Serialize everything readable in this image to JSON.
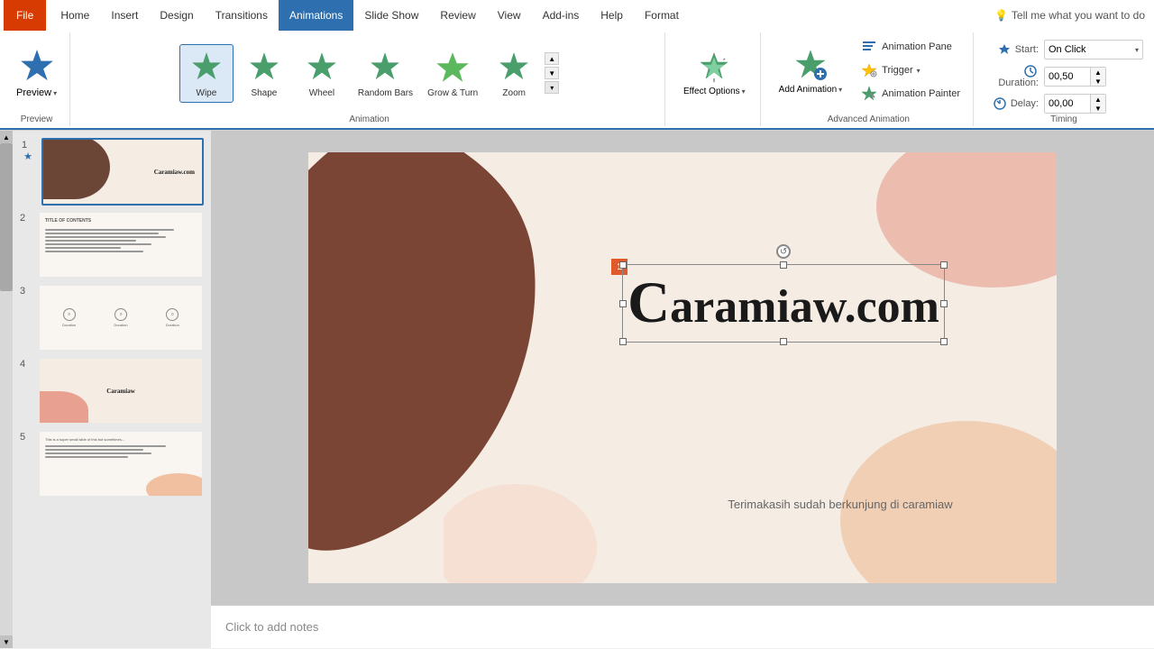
{
  "tabs": {
    "file": "File",
    "home": "Home",
    "insert": "Insert",
    "design": "Design",
    "transitions": "Transitions",
    "animations": "Animations",
    "slideshow": "Slide Show",
    "review": "Review",
    "view": "View",
    "addins": "Add-ins",
    "help": "Help",
    "format": "Format"
  },
  "tellme": {
    "placeholder": "Tell me what you want to do"
  },
  "ribbon": {
    "preview": {
      "label": "Preview",
      "dropdown": ""
    },
    "animations": {
      "label": "Animation",
      "items": [
        {
          "id": "wipe",
          "label": "Wipe",
          "selected": true
        },
        {
          "id": "shape",
          "label": "Shape",
          "selected": false
        },
        {
          "id": "wheel",
          "label": "Wheel",
          "selected": false
        },
        {
          "id": "random-bars",
          "label": "Random Bars",
          "selected": false
        },
        {
          "id": "grow-turn",
          "label": "Grow & Turn",
          "selected": false
        },
        {
          "id": "zoom",
          "label": "Zoom",
          "selected": false
        }
      ]
    },
    "effect_options": {
      "label": "Effect Options",
      "dropdown": ""
    },
    "advanced": {
      "label": "Advanced Animation",
      "animation_pane": "Animation Pane",
      "trigger": "Trigger",
      "add_animation": "Add Animation",
      "animation_painter": "Animation Painter"
    },
    "timing": {
      "label": "Timing",
      "start_label": "Start:",
      "start_value": "On Click",
      "duration_label": "Duration:",
      "duration_value": "00,50",
      "delay_label": "Delay:",
      "delay_value": "00,00"
    }
  },
  "slides": [
    {
      "number": "1",
      "has_star": true
    },
    {
      "number": "2",
      "has_star": false
    },
    {
      "number": "3",
      "has_star": false
    },
    {
      "number": "4",
      "has_star": false
    },
    {
      "number": "5",
      "has_star": false
    }
  ],
  "slide_main": {
    "brand": "Caramiaw.com",
    "brand_c": "C",
    "brand_rest": "aramiaw",
    "brand_dot": ".",
    "brand_com": "com",
    "subtitle": "Terimakasih sudah berkunjung di caramiaw",
    "animation_number": "1"
  },
  "notes": {
    "placeholder": "Click to add notes"
  }
}
